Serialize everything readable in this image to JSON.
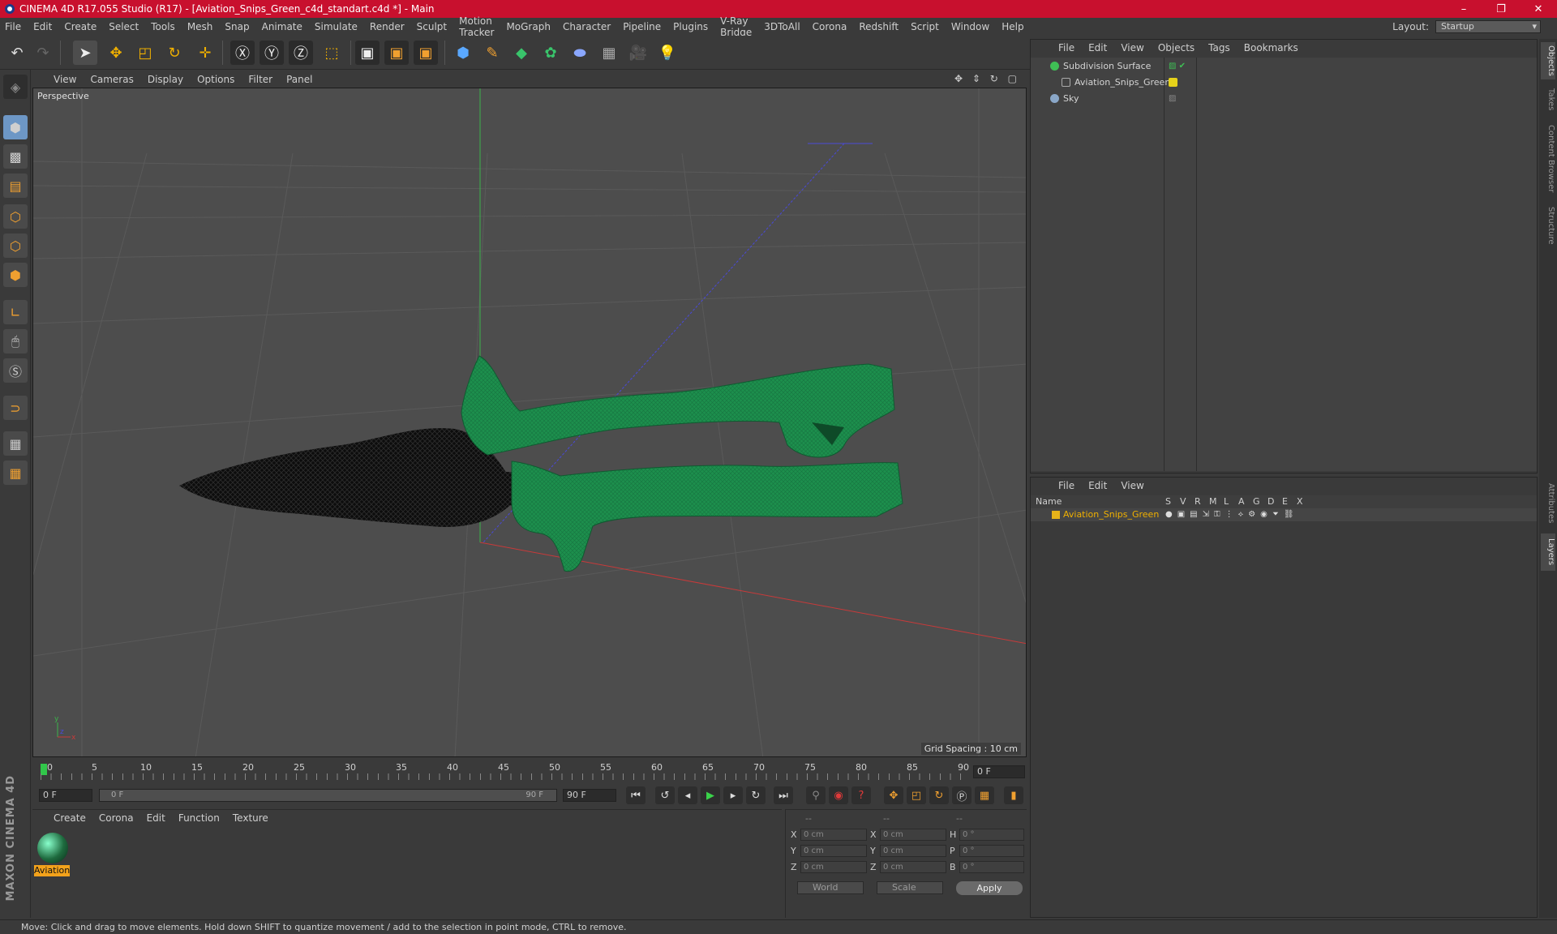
{
  "window": {
    "title": "CINEMA 4D R17.055 Studio (R17) - [Aviation_Snips_Green_c4d_standart.c4d *] - Main",
    "controls": [
      "–",
      "❐",
      "✕"
    ]
  },
  "menubar": {
    "items": [
      "File",
      "Edit",
      "Create",
      "Select",
      "Tools",
      "Mesh",
      "Snap",
      "Animate",
      "Simulate",
      "Render",
      "Sculpt",
      "Motion Tracker",
      "MoGraph",
      "Character",
      "Pipeline",
      "Plugins",
      "V-Ray Bridge",
      "3DToAll",
      "Corona",
      "Redshift",
      "Script",
      "Window",
      "Help"
    ]
  },
  "layout": {
    "label": "Layout:",
    "value": "Startup"
  },
  "viewport": {
    "menu": [
      "View",
      "Cameras",
      "Display",
      "Options",
      "Filter",
      "Panel"
    ],
    "name": "Perspective",
    "grid_spacing": "Grid Spacing : 10 cm",
    "icons": "✥ ⇕ ↻ ▢",
    "axis_labels": {
      "y": "y",
      "x": "x",
      "z": "z"
    }
  },
  "timeline": {
    "ticks": [
      "0",
      "5",
      "10",
      "15",
      "20",
      "25",
      "30",
      "35",
      "40",
      "45",
      "50",
      "55",
      "60",
      "65",
      "70",
      "75",
      "80",
      "85",
      "90"
    ],
    "current_frame": "0 F"
  },
  "transport": {
    "start": "0 F",
    "range_start": "0 F",
    "range_end": "90 F",
    "end": "90 F"
  },
  "material_panel": {
    "menu": [
      "Create",
      "Corona",
      "Edit",
      "Function",
      "Texture"
    ],
    "material_name": "Aviation"
  },
  "coords": {
    "header": [
      "--",
      "--",
      "--"
    ],
    "rows": [
      {
        "a": "X",
        "v1": "0 cm",
        "b": "X",
        "v2": "0 cm",
        "c": "H",
        "v3": "0 °"
      },
      {
        "a": "Y",
        "v1": "0 cm",
        "b": "Y",
        "v2": "0 cm",
        "c": "P",
        "v3": "0 °"
      },
      {
        "a": "Z",
        "v1": "0 cm",
        "b": "Z",
        "v2": "0 cm",
        "c": "B",
        "v3": "0 °"
      }
    ],
    "mode": "World",
    "transform": "Scale",
    "apply": "Apply"
  },
  "objects_panel": {
    "menu": [
      "File",
      "Edit",
      "View",
      "Objects",
      "Tags",
      "Bookmarks"
    ],
    "items": [
      {
        "name": "Subdivision Surface",
        "color": "#3fbf55"
      },
      {
        "name": "Aviation_Snips_Green",
        "color": "#e6d21a"
      },
      {
        "name": "Sky",
        "color": "#8aa7c8"
      }
    ]
  },
  "layers_panel": {
    "menu": [
      "File",
      "Edit",
      "View"
    ],
    "columns": [
      "Name",
      "S",
      "V",
      "R",
      "M",
      "L",
      "A",
      "G",
      "D",
      "E",
      "X"
    ],
    "layer": "Aviation_Snips_Green",
    "layer_color": "#e6b31a"
  },
  "side_tabs": [
    "Objects",
    "Takes",
    "Content Browser",
    "Structure",
    "Attributes",
    "Layers"
  ],
  "status": "Move: Click and drag to move elements. Hold down SHIFT to quantize movement / add to the selection in point mode, CTRL to remove.",
  "brand": "MAXON CINEMA 4D"
}
